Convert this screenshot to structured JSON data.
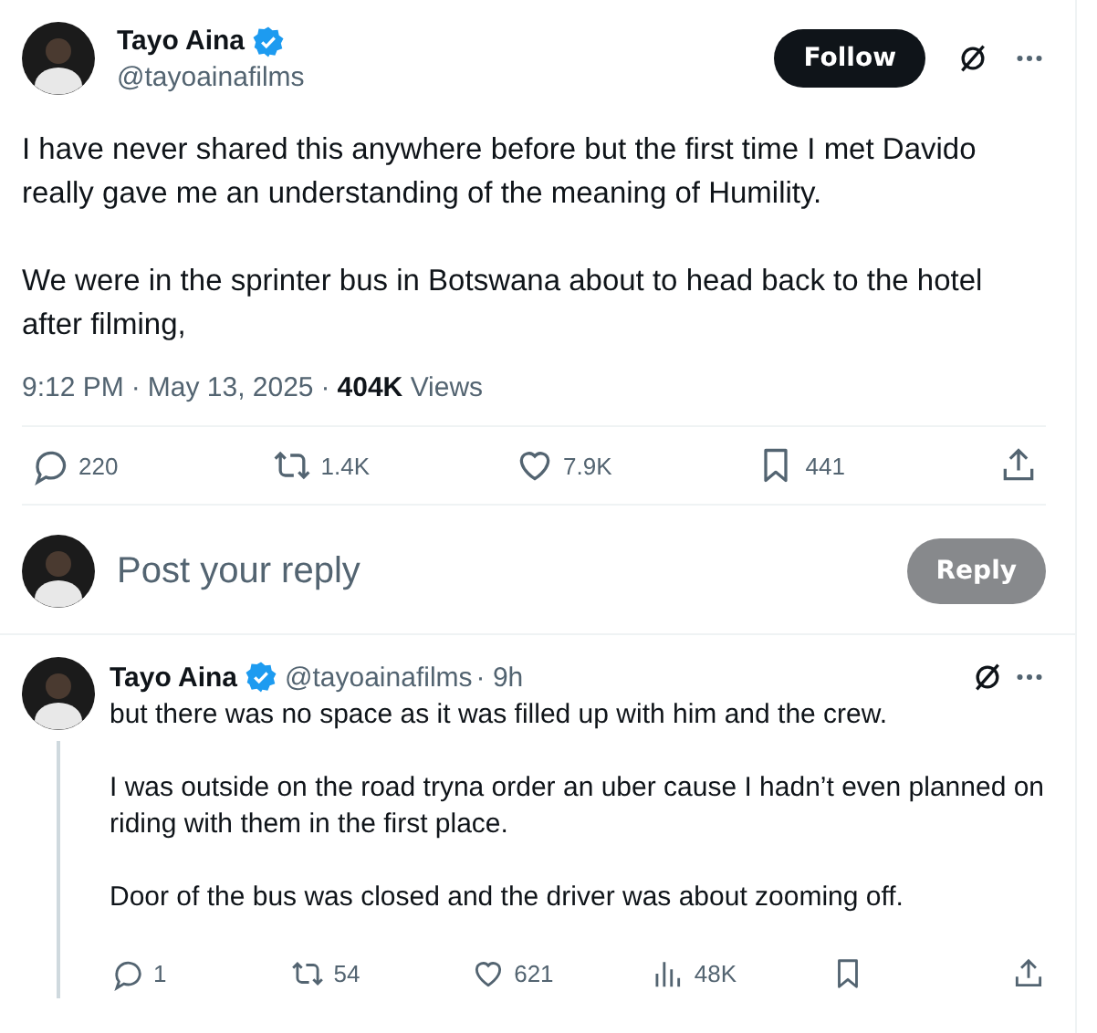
{
  "post": {
    "author": {
      "name": "Tayo Aina",
      "verified": true,
      "handle": "@tayoainafilms"
    },
    "follow_button": "Follow",
    "paragraphs": [
      "I have never shared this anywhere before but the first time I met Davido really gave me an understanding of the meaning of Humility.",
      "We were in the sprinter bus in Botswana about to head back to the hotel after filming,"
    ],
    "time": "9:12 PM",
    "separator": "·",
    "date": "May 13, 2025",
    "views_count": "404K",
    "views_label": "Views",
    "actions": [
      {
        "kind": "reply",
        "count": "220"
      },
      {
        "kind": "repost",
        "count": "1.4K"
      },
      {
        "kind": "like",
        "count": "7.9K"
      },
      {
        "kind": "bookmark",
        "count": "441"
      },
      {
        "kind": "share"
      }
    ]
  },
  "composer": {
    "placeholder": "Post your reply",
    "button": "Reply",
    "disabled": true
  },
  "reply": {
    "author": {
      "name": "Tayo Aina",
      "verified": true,
      "handle": "@tayoainafilms",
      "age": "· 9h"
    },
    "paragraphs": [
      "but there was no space as it was filled up with him and the crew.",
      "I was outside on the road tryna order an uber cause I hadn’t even planned on riding with them in the first place.",
      "Door of the bus was closed and the driver was about zooming off."
    ],
    "actions": [
      {
        "kind": "reply",
        "count": "1"
      },
      {
        "kind": "repost",
        "count": "54"
      },
      {
        "kind": "like",
        "count": "621"
      },
      {
        "kind": "views",
        "count": "48K"
      },
      {
        "kind": "bookmark"
      },
      {
        "kind": "share"
      }
    ]
  }
}
